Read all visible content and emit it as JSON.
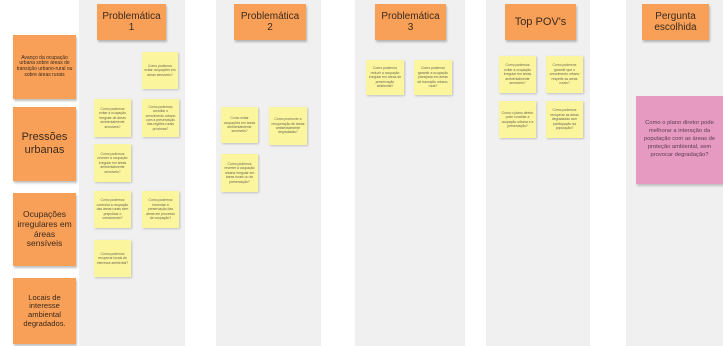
{
  "columns": {
    "p1": "Problemática 1",
    "p2": "Problemática 2",
    "p3": "Problemática 3",
    "pov": "Top POV's",
    "chosen": "Pergunta escolhida"
  },
  "side_labels": {
    "s1": "Avanço da ocupação urbana sobre áreas de transição urbano-rural ou sobre áreas rurais",
    "s2": "Pressões urbanas",
    "s3": "Ocupações irregulares em áreas sensíveis",
    "s4": "Locais de interesse ambiental degradados."
  },
  "notes": {
    "p1": [
      "Como podemos evitar ocupações em áreas sensíveis?",
      "Como podemos evitar a ocupação irregular de áreas ambientalmente sensíveis?",
      "Como podemos conciliar o crescimento urbano com a preservação das regiões rurais próximas?",
      "Como podemos reverter a ocupação irregular em áreas ambientalmente sensíveis?",
      "Como podemos controlar a ocupação das áreas rurais sem prejudicar o crescimento?",
      "Como podemos fomentar a preservação das áreas em processo de ocupação?",
      "Como podemos recuperar locais de interesse ambiental?"
    ],
    "p2": [
      "Como evitar ocupações em áreas ambientalmente sensíveis?",
      "Como promover a recuperação de áreas ambientalmente degradadas?",
      "Como podemos reverter a ocupação urbana irregular em áreas rurais ou de preservação?"
    ],
    "p3": [
      "Como podemos reduzir a ocupação irregular em áreas de preservação ambiental?",
      "Como podemos garantir a ocupação planejada em áreas de transição urbano-rural?"
    ],
    "pov": [
      "Como podemos evitar a ocupação irregular em áreas ambientalmente sensíveis?",
      "Como podemos garantir que o crescimento urbano respeite as áreas rurais?",
      "Como o plano diretor pode conciliar a ocupação urbana e a preservação?",
      "Como podemos recuperar as áreas degradadas com participação da população?"
    ]
  },
  "chosen_question": "Como o plano diretor pode melhorar a interação da população com as áreas de proteção ambiental, sem provocar degradação?"
}
